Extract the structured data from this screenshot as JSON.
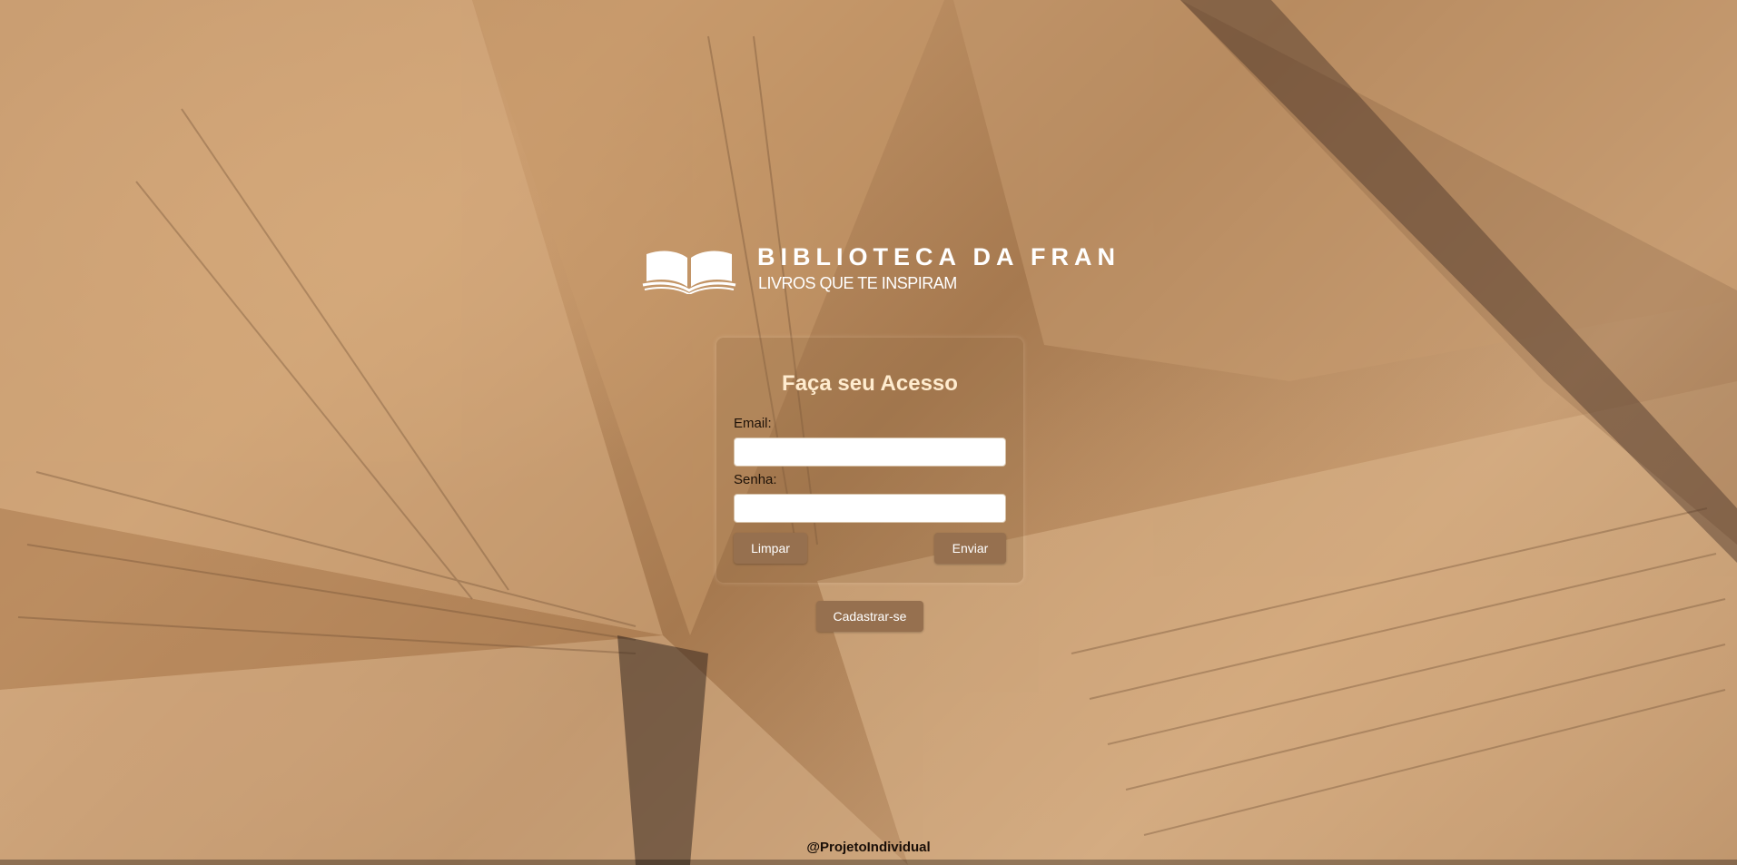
{
  "brand": {
    "title": "BIBLIOTECA DA FRAN",
    "subtitle": "LIVROS QUE TE INSPIRAM",
    "logo_icon": "open-book-icon",
    "text_color": "#ffffff"
  },
  "login": {
    "title": "Faça seu Acesso",
    "email_label": "Email:",
    "email_value": "",
    "password_label": "Senha:",
    "password_value": "",
    "clear_label": "Limpar",
    "submit_label": "Enviar",
    "title_color": "#ffeccf"
  },
  "register": {
    "label": "Cadastrar-se"
  },
  "footer": {
    "text": "@ProjetoIndividual"
  },
  "colors": {
    "button": "#96704f",
    "background": "#b88a60"
  }
}
